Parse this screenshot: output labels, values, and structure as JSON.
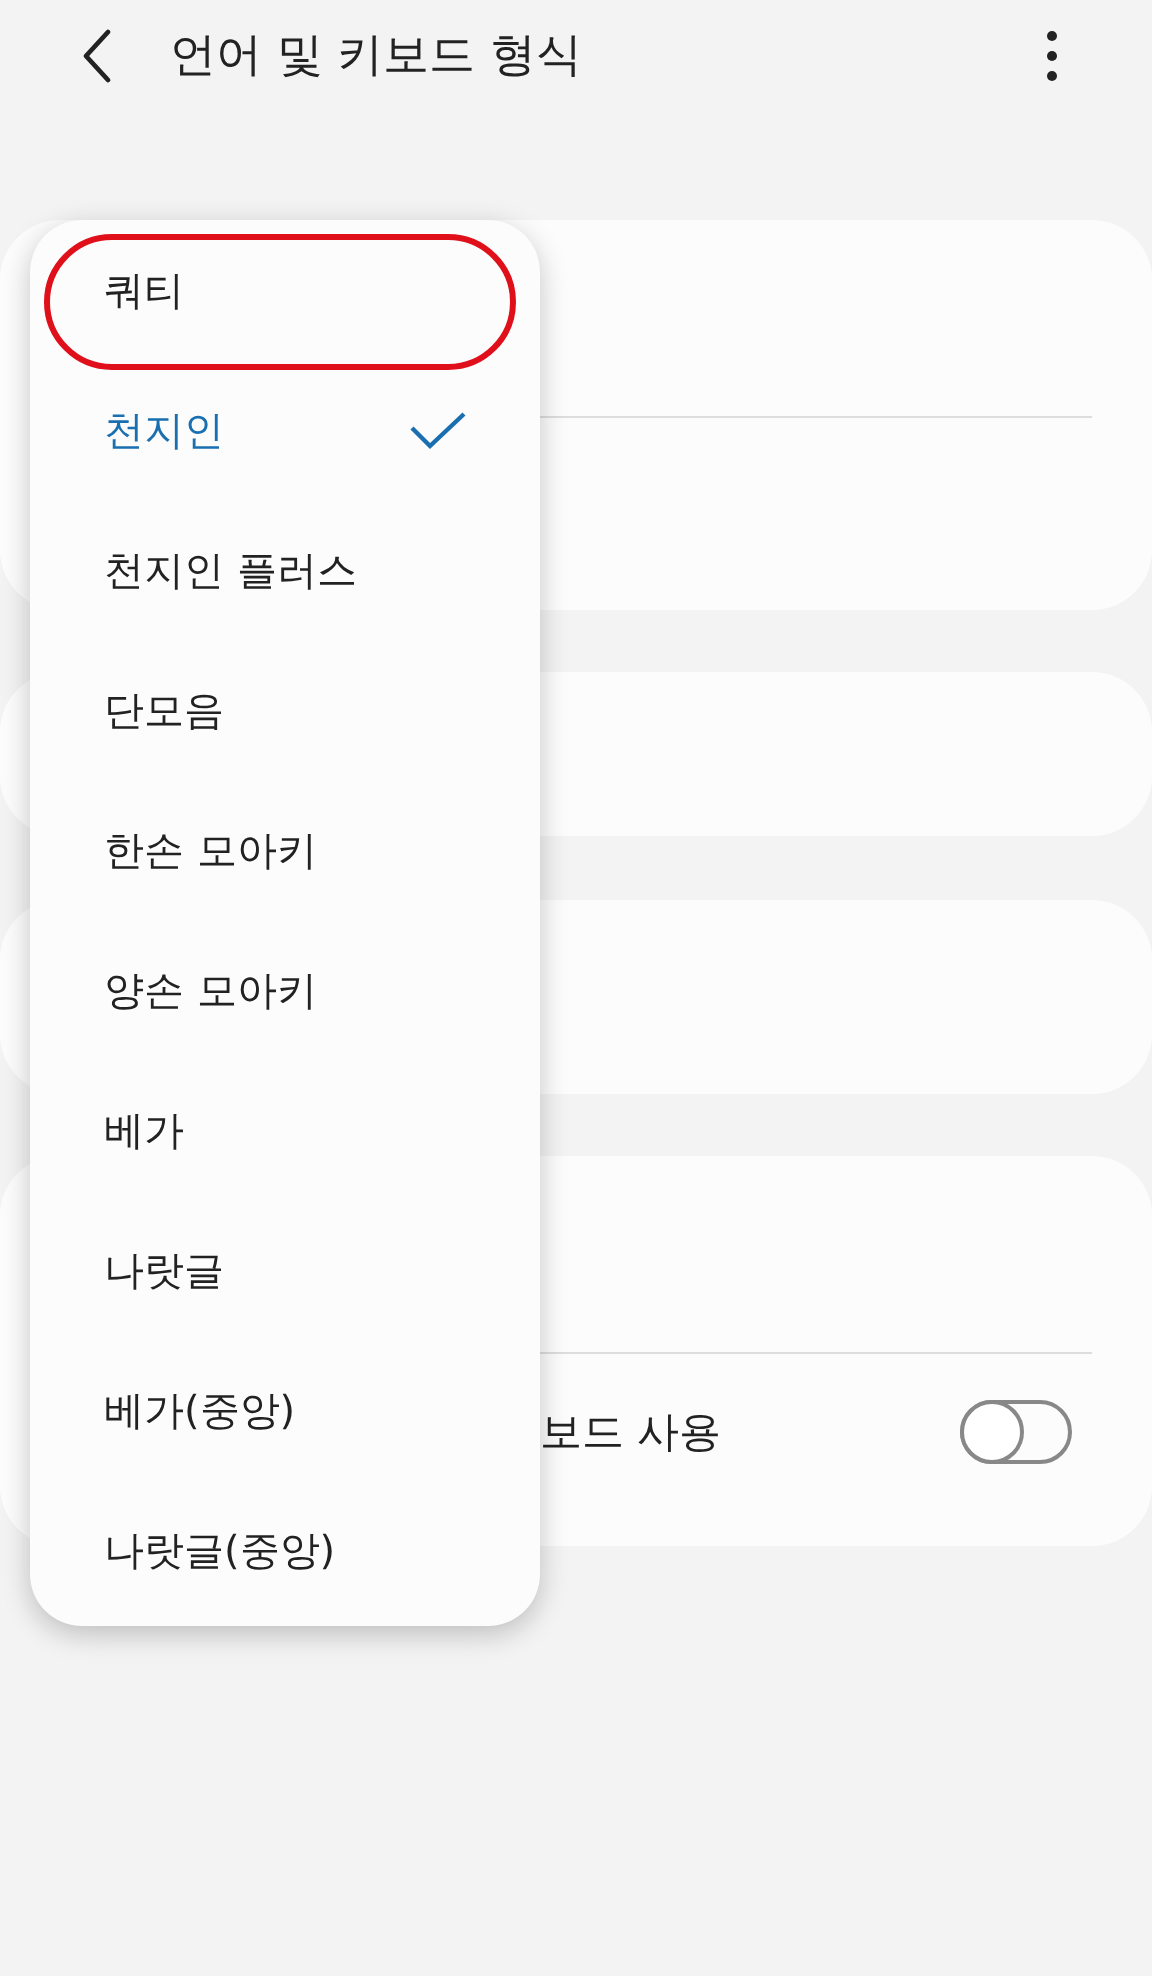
{
  "header": {
    "title": "언어 및 키보드 형식"
  },
  "settings_card": {
    "label": "보드 사용",
    "toggle": {
      "on": false
    }
  },
  "menu": {
    "items": [
      {
        "label": "쿼티",
        "selected": false,
        "highlighted": true
      },
      {
        "label": "천지인",
        "selected": true,
        "highlighted": false
      },
      {
        "label": "천지인 플러스",
        "selected": false,
        "highlighted": false
      },
      {
        "label": "단모음",
        "selected": false,
        "highlighted": false
      },
      {
        "label": "한손 모아키",
        "selected": false,
        "highlighted": false
      },
      {
        "label": "양손 모아키",
        "selected": false,
        "highlighted": false
      },
      {
        "label": "베가",
        "selected": false,
        "highlighted": false
      },
      {
        "label": "나랏글",
        "selected": false,
        "highlighted": false
      },
      {
        "label": "베가(중앙)",
        "selected": false,
        "highlighted": false
      },
      {
        "label": "나랏글(중앙)",
        "selected": false,
        "highlighted": false
      }
    ]
  }
}
